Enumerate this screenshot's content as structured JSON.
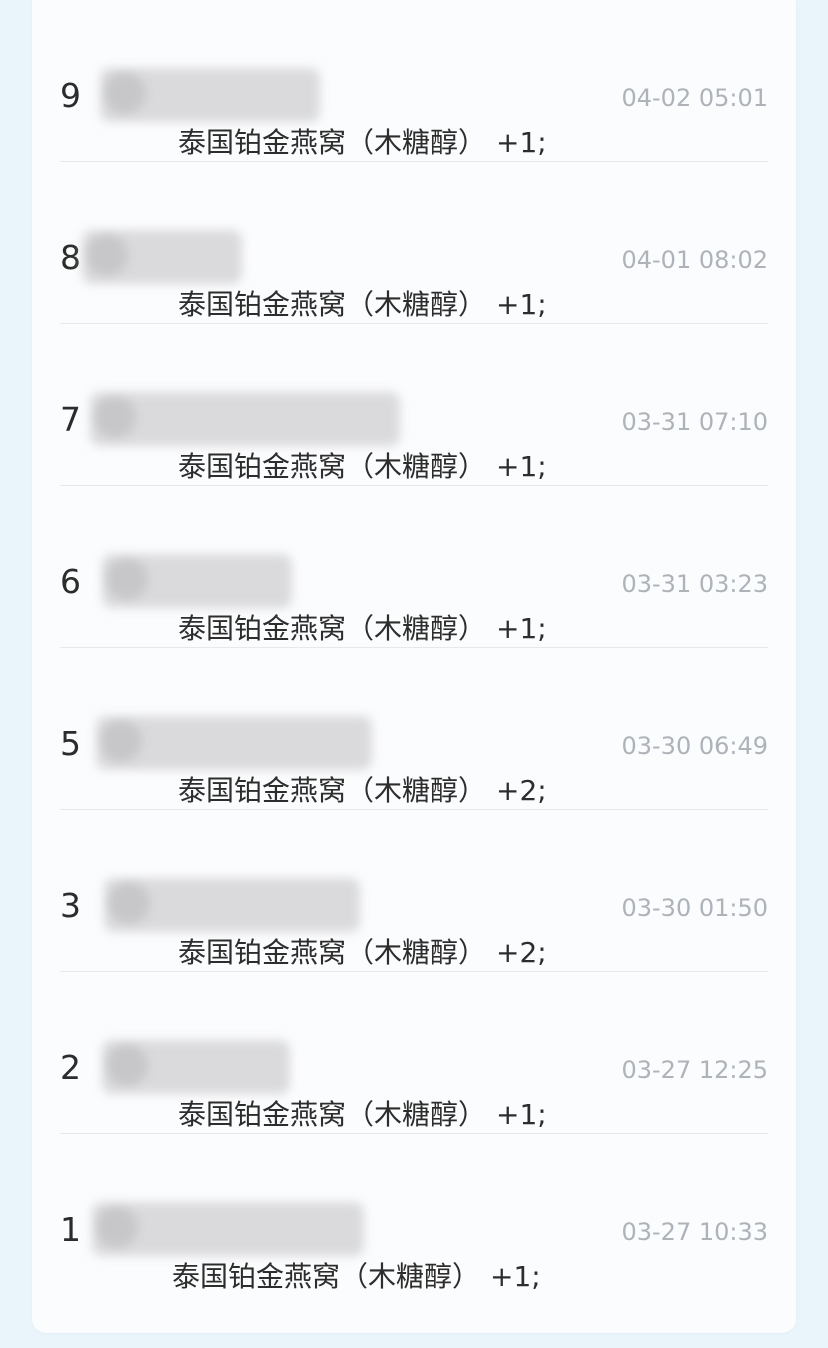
{
  "records": [
    {
      "rank": "9",
      "time": "04-02 05:01",
      "product": "泰国铂金燕窝（木糖醇）",
      "qty": "+1;"
    },
    {
      "rank": "8",
      "time": "04-01 08:02",
      "product": "泰国铂金燕窝（木糖醇）",
      "qty": "+1;"
    },
    {
      "rank": "7",
      "time": "03-31 07:10",
      "product": "泰国铂金燕窝（木糖醇）",
      "qty": "+1;"
    },
    {
      "rank": "6",
      "time": "03-31 03:23",
      "product": "泰国铂金燕窝（木糖醇）",
      "qty": "+1;"
    },
    {
      "rank": "5",
      "time": "03-30 06:49",
      "product": "泰国铂金燕窝（木糖醇）",
      "qty": "+2;"
    },
    {
      "rank": "3",
      "time": "03-30 01:50",
      "product": "泰国铂金燕窝（木糖醇）",
      "qty": "+2;"
    },
    {
      "rank": "2",
      "time": "03-27 12:25",
      "product": "泰国铂金燕窝（木糖醇）",
      "qty": "+1;"
    },
    {
      "rank": "1",
      "time": "03-27 10:33",
      "product": "泰国铂金燕窝（木糖醇）",
      "qty": "+1;"
    }
  ],
  "colors": {
    "background": "#e9f5fa",
    "card": "#fbfcfd",
    "time_text": "#adb3b9",
    "body_text": "#2d2d2d"
  }
}
